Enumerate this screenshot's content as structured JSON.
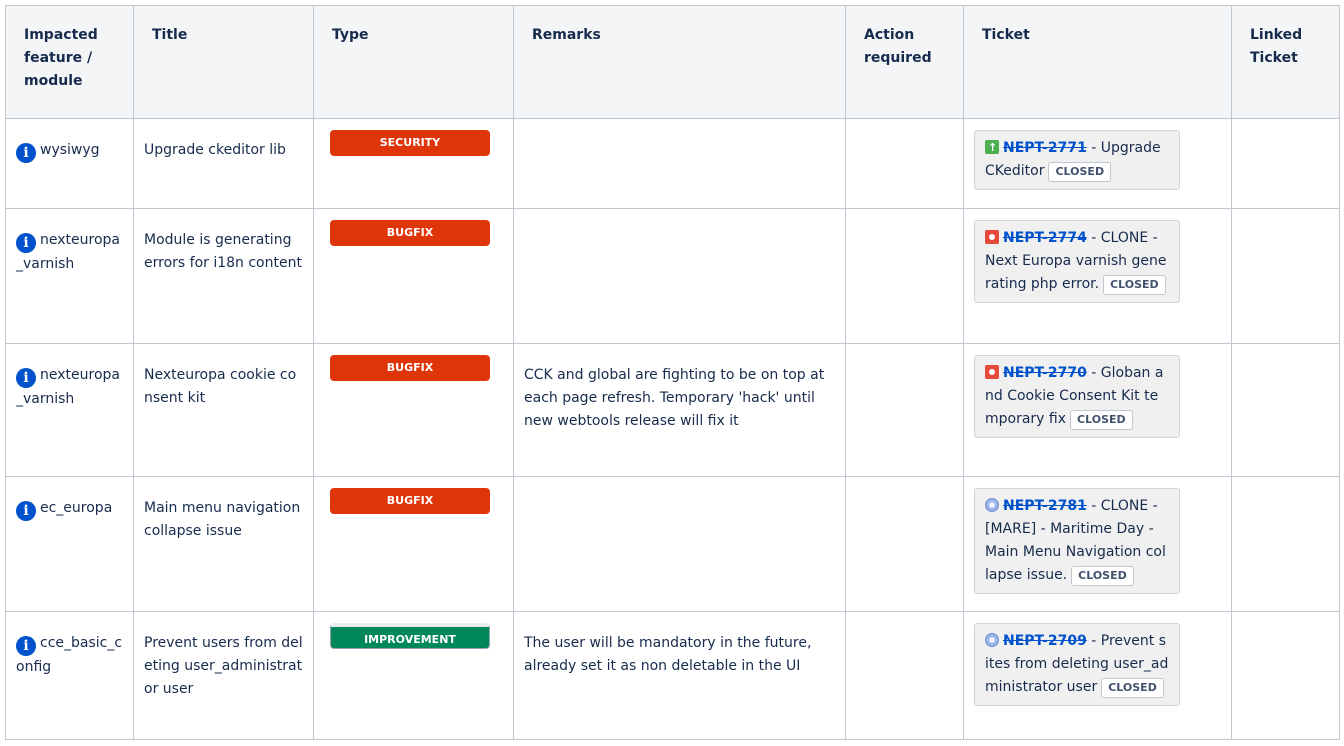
{
  "headers": {
    "feature": "Impacted feature / module",
    "title": "Title",
    "type": "Type",
    "remarks": "Remarks",
    "action": "Action required",
    "ticket": "Ticket",
    "linked": "Linked Ticket"
  },
  "rows": [
    {
      "feature": "wysiwyg",
      "title": "Upgrade ckeditor lib",
      "type": "SECURITY",
      "type_color": "#de350b",
      "remarks": "",
      "action": "",
      "ticket_icon": "story-icon",
      "ticket_key": "NEPT-2771",
      "ticket_summary": " - Upgrade CKeditor",
      "ticket_status": "CLOSED",
      "linked": ""
    },
    {
      "feature": "nexteuropa_varnish",
      "title": "Module is generating errors for i18n content",
      "type": "BUGFIX",
      "type_color": "#de350b",
      "remarks": "",
      "action": "",
      "ticket_icon": "bug-icon",
      "ticket_key": "NEPT-2774",
      "ticket_summary": " - CLONE - Next Europa varnish generating php error.",
      "ticket_status": "CLOSED",
      "linked": ""
    },
    {
      "feature": "nexteuropa_varnish",
      "title": "Nexteuropa cookie consent kit",
      "type": "BUGFIX",
      "type_color": "#de350b",
      "remarks": "CCK and global are fighting to be on top at each page refresh. Temporary 'hack' until new webtools release will fix it",
      "action": "",
      "ticket_icon": "bug-icon",
      "ticket_key": "NEPT-2770",
      "ticket_summary": " - Globan and Cookie Consent Kit temporary fix",
      "ticket_status": "CLOSED",
      "linked": ""
    },
    {
      "feature": "ec_europa",
      "title": "Main menu navigation collapse issue",
      "type": "BUGFIX",
      "type_color": "#de350b",
      "remarks": "",
      "action": "",
      "ticket_icon": "task-icon",
      "ticket_key": "NEPT-2781",
      "ticket_summary": " - CLONE - [MARE] - Maritime Day - Main Menu Navigation collapse issue.",
      "ticket_status": "CLOSED",
      "linked": ""
    },
    {
      "feature": "cce_basic_config",
      "title": "Prevent users from deleting user_administrator user",
      "type": "IMPROVEMENT",
      "type_color": "#00875a",
      "remarks": "The user will be mandatory in the future, already set it as non deletable in the UI",
      "action": "",
      "ticket_icon": "task-icon",
      "ticket_key": "NEPT-2709",
      "ticket_summary": " - Prevent sites from deleting user_administrator user",
      "ticket_status": "CLOSED",
      "linked": ""
    }
  ]
}
